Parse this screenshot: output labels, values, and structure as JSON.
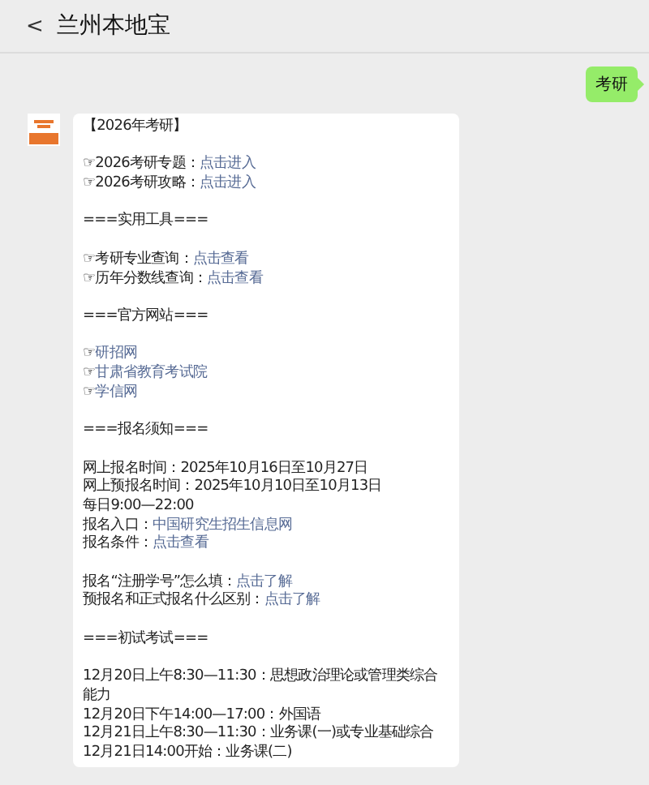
{
  "header": {
    "back": "<",
    "title": "兰州本地宝"
  },
  "sent_message": "考研",
  "reply_blocks": [
    [
      {
        "text": "【2026年考研】"
      }
    ],
    [
      {
        "text": "☞2026考研专题：",
        "link": "点击进入"
      },
      {
        "text": "☞2026考研攻略：",
        "link": "点击进入"
      }
    ],
    [
      {
        "text": "===实用工具==="
      }
    ],
    [
      {
        "text": "☞考研专业查询：",
        "link": "点击查看"
      },
      {
        "text": "☞历年分数线查询：",
        "link": "点击查看"
      }
    ],
    [
      {
        "text": "===官方网站==="
      }
    ],
    [
      {
        "text": "☞",
        "link": "研招网"
      },
      {
        "text": "☞",
        "link": "甘肃省教育考试院"
      },
      {
        "text": "☞",
        "link": "学信网"
      }
    ],
    [
      {
        "text": "===报名须知==="
      }
    ],
    [
      {
        "text": "网上报名时间：2025年10月16日至10月27日"
      },
      {
        "text": "网上预报名时间：2025年10月10日至10月13日"
      },
      {
        "text": "每日9:00—22:00"
      },
      {
        "text": "报名入口：",
        "link": "中国研究生招生信息网"
      },
      {
        "text": "报名条件：",
        "link": "点击查看"
      }
    ],
    [
      {
        "text": "报名“注册学号”怎么填：",
        "link": "点击了解"
      },
      {
        "text": "预报名和正式报名什么区别：",
        "link": "点击了解"
      }
    ],
    [
      {
        "text": "===初试考试==="
      }
    ],
    [
      {
        "text": "12月20日上午8:30—11:30：思想政治理论或管理类综合能力"
      },
      {
        "text": "12月20日下午14:00—17:00：外国语"
      },
      {
        "text": "12月21日上午8:30—11:30：业务课(一)或专业基础综合"
      },
      {
        "text": "12月21日14:00开始：业务课(二)"
      }
    ]
  ]
}
